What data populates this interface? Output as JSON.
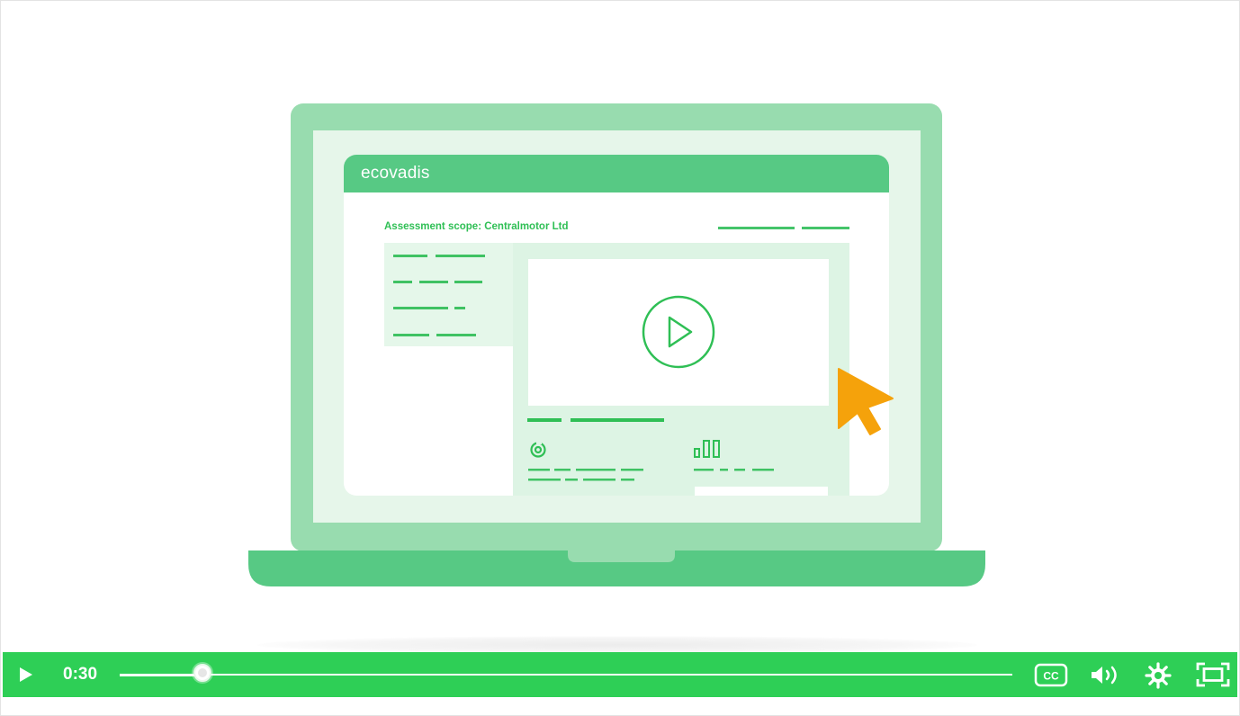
{
  "video": {
    "brand_label": "ecovadis",
    "screen_title": "Assessment scope: Centralmotor Ltd"
  },
  "player": {
    "current_time": "0:30",
    "progress_fraction": 0.093,
    "accent_color": "#2ecf56"
  },
  "icons": {
    "play": "play-icon",
    "captions": "closed-captions-icon",
    "volume": "volume-icon",
    "settings": "gear-icon",
    "fullscreen": "fullscreen-icon",
    "cursor": "mouse-pointer-icon"
  },
  "colors": {
    "laptop_frame": "#98dcaf",
    "header_bar": "#57c984",
    "content_green": "#2fbf55",
    "pointer": "#f5a20b"
  }
}
